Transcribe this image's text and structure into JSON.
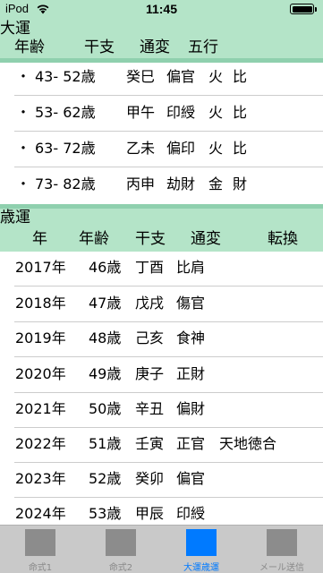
{
  "status_bar": {
    "carrier": "iPod",
    "time": "11:45"
  },
  "taiun": {
    "title": "大運",
    "columns": [
      "年齢",
      "干支",
      "通変",
      "五行"
    ],
    "rows": [
      {
        "bullet": "・",
        "age": "43- 52歳",
        "kanshi": "癸巳",
        "tsuhen": "偏官",
        "gogyo": "火",
        "hi": "比"
      },
      {
        "bullet": "・",
        "age": "53- 62歳",
        "kanshi": "甲午",
        "tsuhen": "印綬",
        "gogyo": "火",
        "hi": "比"
      },
      {
        "bullet": "・",
        "age": "63- 72歳",
        "kanshi": "乙未",
        "tsuhen": "偏印",
        "gogyo": "火",
        "hi": "比"
      },
      {
        "bullet": "・",
        "age": "73- 82歳",
        "kanshi": "丙申",
        "tsuhen": "劫財",
        "gogyo": "金",
        "hi": "財"
      }
    ]
  },
  "sainen": {
    "title": "歳運",
    "columns": [
      "年",
      "年齢",
      "干支",
      "通変",
      "転換"
    ],
    "rows": [
      {
        "year": "2017年",
        "age": "46歳",
        "kanshi": "丁酉",
        "tsuhen": "比肩",
        "tenkan": ""
      },
      {
        "year": "2018年",
        "age": "47歳",
        "kanshi": "戊戌",
        "tsuhen": "傷官",
        "tenkan": ""
      },
      {
        "year": "2019年",
        "age": "48歳",
        "kanshi": "己亥",
        "tsuhen": "食神",
        "tenkan": ""
      },
      {
        "year": "2020年",
        "age": "49歳",
        "kanshi": "庚子",
        "tsuhen": "正財",
        "tenkan": ""
      },
      {
        "year": "2021年",
        "age": "50歳",
        "kanshi": "辛丑",
        "tsuhen": "偏財",
        "tenkan": ""
      },
      {
        "year": "2022年",
        "age": "51歳",
        "kanshi": "壬寅",
        "tsuhen": "正官",
        "tenkan": "天地徳合"
      },
      {
        "year": "2023年",
        "age": "52歳",
        "kanshi": "癸卯",
        "tsuhen": "偏官",
        "tenkan": ""
      },
      {
        "year": "2024年",
        "age": "53歳",
        "kanshi": "甲辰",
        "tsuhen": "印綬",
        "tenkan": ""
      }
    ]
  },
  "tabs": [
    {
      "label": "命式1",
      "icon": "placeholder-icon",
      "active": false
    },
    {
      "label": "命式2",
      "icon": "placeholder-icon",
      "active": false
    },
    {
      "label": "大運歳運",
      "icon": "placeholder-icon",
      "active": true
    },
    {
      "label": "メール送信",
      "icon": "placeholder-icon",
      "active": false
    }
  ],
  "colors": {
    "header_bg": "#b4e4c8",
    "divider": "#8fd0ae",
    "tab_active": "#007aff",
    "tab_inactive": "#8c8c8c"
  }
}
